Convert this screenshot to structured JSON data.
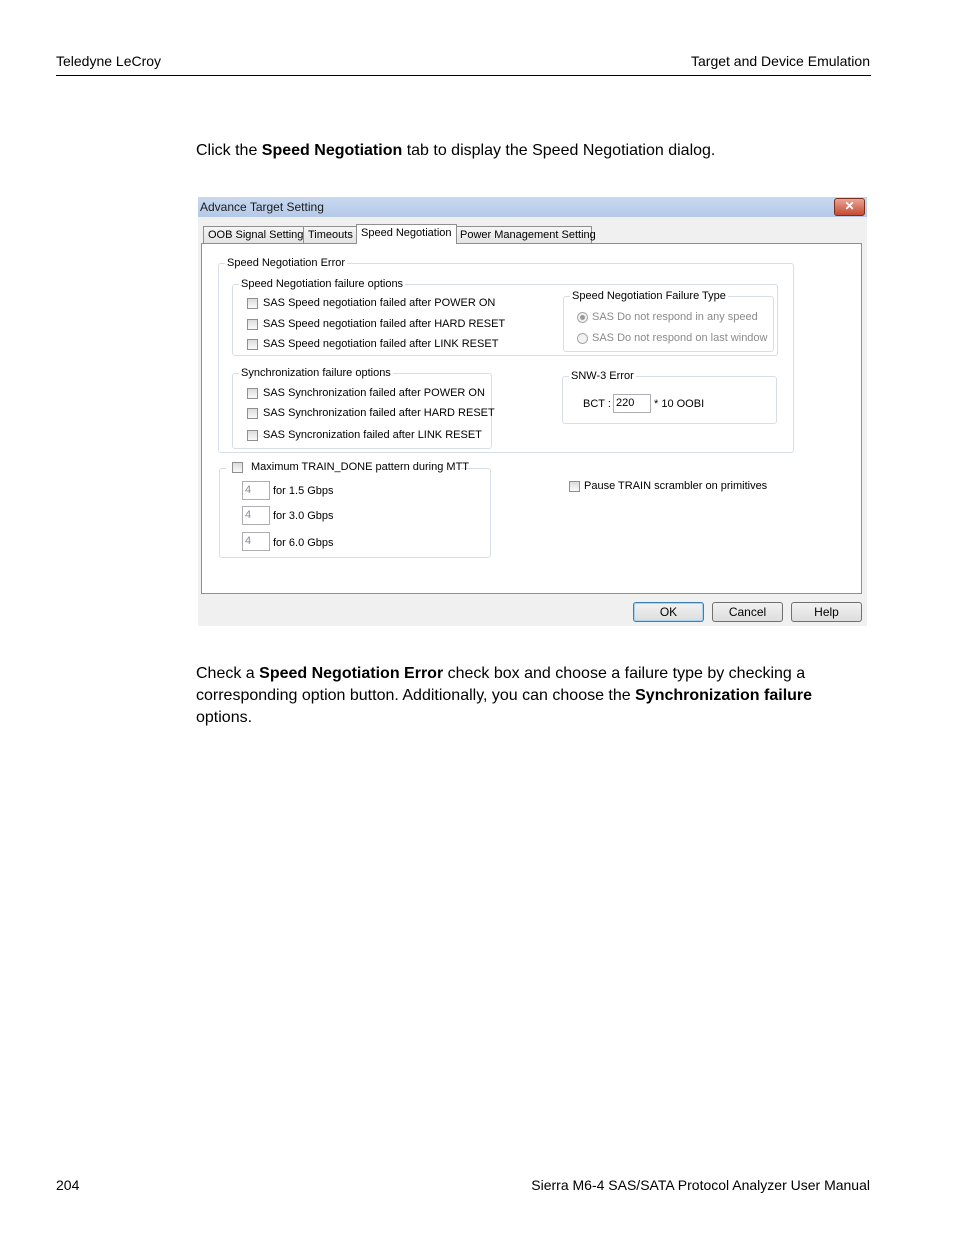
{
  "header": {
    "left": "Teledyne LeCroy",
    "right": "Target and Device Emulation"
  },
  "intro": {
    "before": "Click the ",
    "bold": "Speed Negotiation",
    "after": " tab to display the Speed Negotiation dialog."
  },
  "dialog": {
    "title": "Advance Target Setting",
    "close_symbol": "✕",
    "tabs": [
      "OOB Signal Setting",
      "Timeouts",
      "Speed Negotiation",
      "Power Management Setting"
    ],
    "active_tab": "Speed Negotiation",
    "speed_error_group": "Speed Negotiation Error",
    "failure_options_group": "Speed Negotiation failure options",
    "failure_options": [
      "SAS Speed negotiation failed after POWER ON",
      "SAS Speed negotiation failed after HARD RESET",
      "SAS Speed negotiation failed after LINK RESET"
    ],
    "failure_type_group": "Speed Negotiation Failure Type",
    "failure_types": [
      "SAS Do not respond in any speed",
      "SAS Do not respond on last window"
    ],
    "sync_group": "Synchronization failure options",
    "sync_options": [
      "SAS Synchronization failed after POWER ON",
      "SAS Synchronization failed after HARD RESET",
      "SAS Syncronization failed after LINK RESET"
    ],
    "snw3_group": "SNW-3 Error",
    "bct_label": "BCT :",
    "bct_value": "220",
    "bct_suffix": "* 10  OOBI",
    "max_train_label": "Maximum TRAIN_DONE pattern during MTT",
    "train_rates": [
      {
        "value": "4",
        "label": "for 1.5 Gbps"
      },
      {
        "value": "4",
        "label": "for 3.0 Gbps"
      },
      {
        "value": "4",
        "label": "for 6.0 Gbps"
      }
    ],
    "pause_train_label": "Pause TRAIN scrambler on primitives",
    "buttons": {
      "ok": "OK",
      "cancel": "Cancel",
      "help": "Help"
    }
  },
  "body2": {
    "t1": "Check a ",
    "b1": "Speed Negotiation Error",
    "t2": " check box and choose a failure type by checking a corresponding option button. Additionally, you can choose the ",
    "b2": "Synchronization failure",
    "t3": " options."
  },
  "footer": {
    "page_number": "204",
    "manual_title": "Sierra M6-4 SAS/SATA Protocol Analyzer User Manual"
  }
}
